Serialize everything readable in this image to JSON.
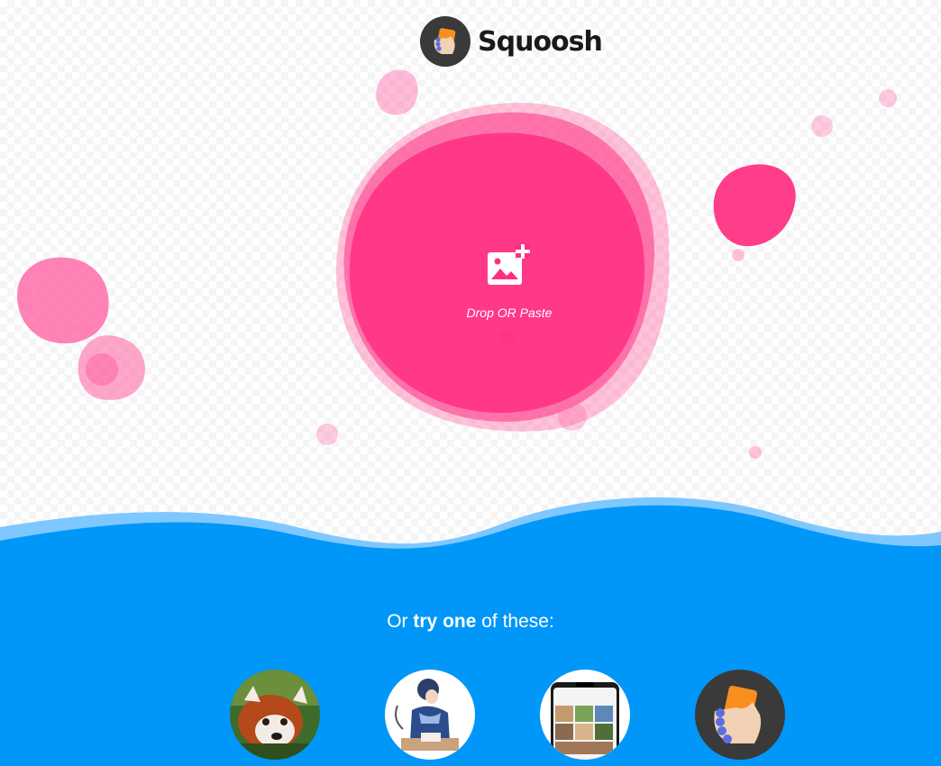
{
  "header": {
    "app_name": "Squoosh",
    "logo_icon": "squoosh-hand-logo-icon"
  },
  "drop_zone": {
    "icon": "add-image-icon",
    "label": "Drop OR Paste"
  },
  "demos": {
    "heading_pre": "Or",
    "heading_try": "try",
    "heading_one": "one",
    "heading_post": "of these:",
    "items": [
      {
        "name": "red-panda-photo"
      },
      {
        "name": "illustration-woman-writing"
      },
      {
        "name": "phone-screenshot"
      },
      {
        "name": "squoosh-logo-icon"
      }
    ]
  },
  "colors": {
    "pink": "#ff3385",
    "blue": "#0097f8",
    "light_blue": "#7ec8ff",
    "logo_bg": "#3a3a3a",
    "logo_orange": "#f78e1e"
  }
}
